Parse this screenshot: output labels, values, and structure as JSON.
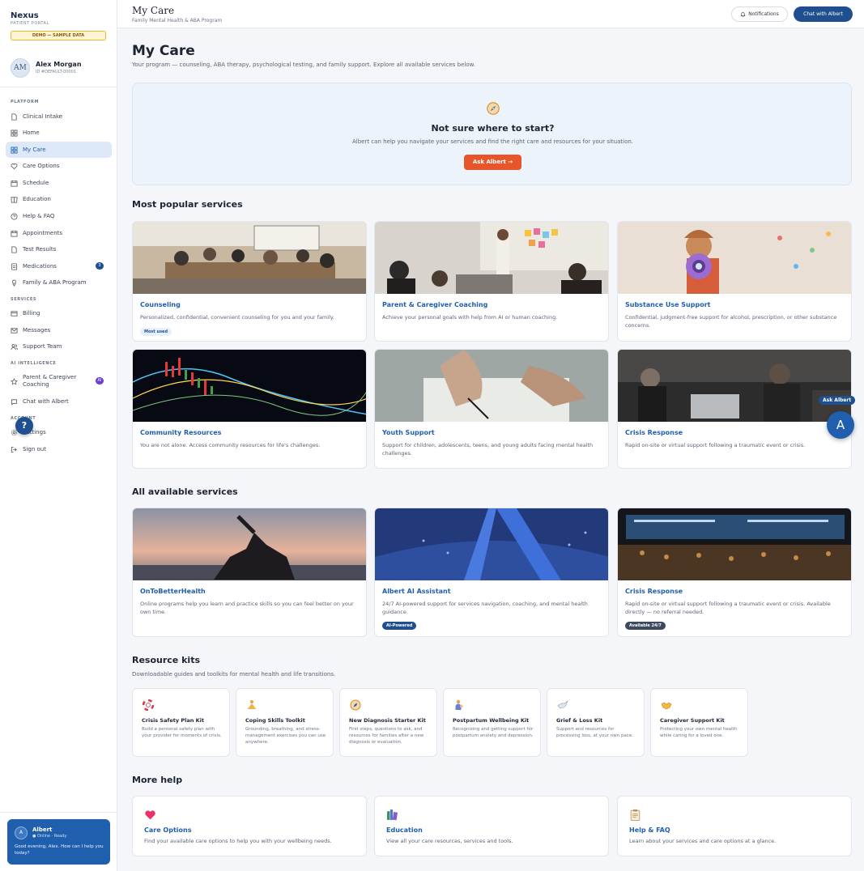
{
  "brand": {
    "name": "Nexus",
    "subtitle": "PATIENT PORTAL",
    "demo_badge": "DEMO — SAMPLE DATA"
  },
  "user": {
    "initials": "AM",
    "name": "Alex Morgan",
    "id": "ID #DEFAULT-00001"
  },
  "sidebar": {
    "platform_label": "PLATFORM",
    "platform_items": [
      {
        "label": "Clinical Intake",
        "icon": "document-icon"
      },
      {
        "label": "Home",
        "icon": "grid-icon"
      },
      {
        "label": "My Care",
        "icon": "grid-icon",
        "active": true
      },
      {
        "label": "Care Options",
        "icon": "heart-icon"
      },
      {
        "label": "Schedule",
        "icon": "calendar-icon"
      },
      {
        "label": "Education",
        "icon": "book-icon"
      },
      {
        "label": "Help & FAQ",
        "icon": "help-circle-icon"
      },
      {
        "label": "Appointments",
        "icon": "calendar-icon"
      },
      {
        "label": "Test Results",
        "icon": "document-icon"
      },
      {
        "label": "Medications",
        "icon": "pill-icon",
        "badge": "3"
      },
      {
        "label": "Family & ABA Program",
        "icon": "family-icon"
      }
    ],
    "services_label": "SERVICES",
    "services_items": [
      {
        "label": "Billing",
        "icon": "card-icon"
      },
      {
        "label": "Messages",
        "icon": "mail-icon"
      },
      {
        "label": "Support Team",
        "icon": "users-icon"
      }
    ],
    "ai_label": "AI INTELLIGENCE",
    "ai_items": [
      {
        "label": "Parent & Caregiver Coaching",
        "icon": "star-icon",
        "badge": "AI"
      },
      {
        "label": "Chat with Albert",
        "icon": "chat-icon"
      }
    ],
    "account_label": "ACCOUNT",
    "account_items": [
      {
        "label": "Settings",
        "icon": "gear-icon"
      },
      {
        "label": "Sign out",
        "icon": "logout-icon"
      }
    ]
  },
  "albert_widget": {
    "initial": "A",
    "name": "Albert",
    "status": "● Online · Ready",
    "message": "Good evening, Alex. How can I help you today?"
  },
  "header": {
    "title": "My Care",
    "subtitle": "Family Mental Health & ABA Program",
    "notifications_label": "Notifications",
    "chat_label": "Chat with Albert"
  },
  "page": {
    "title": "My Care",
    "subtitle": "Your program — counseling, ABA therapy, psychological testing, and family support. Explore all available services below."
  },
  "hero": {
    "icon": "compass-icon",
    "title": "Not sure where to start?",
    "text": "Albert can help you navigate your services and find the right care and resources for your situation.",
    "button": "Ask Albert →"
  },
  "popular": {
    "title": "Most popular services",
    "cards": [
      {
        "title": "Counseling",
        "desc": "Personalized, confidential, convenient counseling for you and your family.",
        "tag": "Most used"
      },
      {
        "title": "Parent & Caregiver Coaching",
        "desc": "Achieve your personal goals with help from AI or human coaching."
      },
      {
        "title": "Substance Use Support",
        "desc": "Confidential, judgment-free support for alcohol, prescription, or other substance concerns."
      },
      {
        "title": "Community Resources",
        "desc": "You are not alone. Access community resources for life's challenges."
      },
      {
        "title": "Youth Support",
        "desc": "Support for children, adolescents, teens, and young adults facing mental health challenges."
      },
      {
        "title": "Crisis Response",
        "desc": "Rapid on-site or virtual support following a traumatic event or crisis."
      }
    ]
  },
  "all_services": {
    "title": "All available services",
    "cards": [
      {
        "title": "OnToBetterHealth",
        "desc": "Online programs help you learn and practice skills so you can feel better on your own time."
      },
      {
        "title": "Albert AI Assistant",
        "desc": "24/7 AI-powered support for services navigation, coaching, and mental health guidance.",
        "tag": "AI-Powered"
      },
      {
        "title": "Crisis Response",
        "desc": "Rapid on-site or virtual support following a traumatic event or crisis. Available directly — no referral needed.",
        "tag": "Available 24/7"
      }
    ]
  },
  "kits": {
    "title": "Resource kits",
    "subtitle": "Downloadable guides and toolkits for mental health and life transitions.",
    "items": [
      {
        "icon": "lifebuoy-icon",
        "title": "Crisis Safety Plan Kit",
        "desc": "Build a personal safety plan with your provider for moments of crisis."
      },
      {
        "icon": "meditation-icon",
        "title": "Coping Skills Toolkit",
        "desc": "Grounding, breathing, and stress-management exercises you can use anywhere."
      },
      {
        "icon": "compass-icon",
        "title": "New Diagnosis Starter Kit",
        "desc": "First steps, questions to ask, and resources for families after a new diagnosis or evaluation."
      },
      {
        "icon": "parent-icon",
        "title": "Postpartum Wellbeing Kit",
        "desc": "Recognizing and getting support for postpartum anxiety and depression."
      },
      {
        "icon": "dove-icon",
        "title": "Grief & Loss Kit",
        "desc": "Support and resources for processing loss, at your own pace."
      },
      {
        "icon": "handshake-icon",
        "title": "Caregiver Support Kit",
        "desc": "Protecting your own mental health while caring for a loved one."
      }
    ]
  },
  "more_help": {
    "title": "More help",
    "cards": [
      {
        "icon": "heart-icon",
        "title": "Care Options",
        "desc": "Find your available care options to help you with your wellbeing needs."
      },
      {
        "icon": "books-icon",
        "title": "Education",
        "desc": "View all your care resources, services and tools."
      },
      {
        "icon": "clipboard-icon",
        "title": "Help & FAQ",
        "desc": "Learn about your services and care options at a glance."
      }
    ]
  },
  "floating": {
    "ask_label": "Ask Albert",
    "fab_initial": "A",
    "help_fab": "?"
  },
  "colors": {
    "brand_blue": "#1f4f8f",
    "link_blue": "#1f5fae",
    "accent_orange": "#e8552b",
    "ai_purple": "#6b3fd6"
  }
}
